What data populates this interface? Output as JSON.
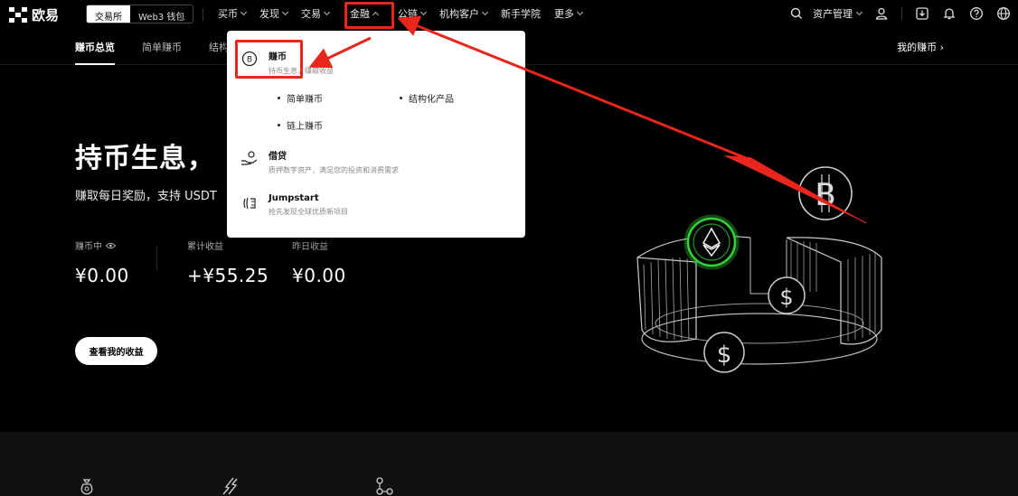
{
  "brand": {
    "name": "欧易"
  },
  "mode_switch": {
    "exchange": "交易所",
    "wallet": "Web3 钱包"
  },
  "nav": {
    "items": [
      {
        "label": "买币",
        "has_chevron": true
      },
      {
        "label": "发现",
        "has_chevron": true
      },
      {
        "label": "交易",
        "has_chevron": true
      },
      {
        "label": "金融",
        "has_chevron": true,
        "open": true
      },
      {
        "label": "公链",
        "has_chevron": true
      },
      {
        "label": "机构客户",
        "has_chevron": true
      },
      {
        "label": "新手学院",
        "has_chevron": false
      },
      {
        "label": "更多",
        "has_chevron": true
      }
    ],
    "assets": "资产管理"
  },
  "subnav": {
    "tabs": [
      "赚币总览",
      "简单赚币",
      "结构"
    ],
    "active": "赚币总览",
    "my_coin": "我的赚币 ›"
  },
  "hero": {
    "title": "持币生息，",
    "subtitle": "赚取每日奖励，支持 USDT"
  },
  "stats": [
    {
      "label": "赚币中",
      "value": "¥0.00",
      "has_eye_icon": true
    },
    {
      "label": "累计收益",
      "value": "+¥55.25"
    },
    {
      "label": "昨日收益",
      "value": "¥0.00"
    }
  ],
  "earn_button": "查看我的收益",
  "dropdown": {
    "earn": {
      "title": "赚币",
      "desc": "持币生息，赚取收益"
    },
    "earn_sub": [
      "简单赚币",
      "结构化产品",
      "链上赚币"
    ],
    "loan": {
      "title": "借贷",
      "desc": "质押数字资产，满足您的投资和消费需求"
    },
    "jumpstart": {
      "title": "Jumpstart",
      "desc": "抢先发现全球优质新项目"
    }
  },
  "colors": {
    "accent_red": "#e8261b",
    "eth_glow": "#35d03a"
  }
}
